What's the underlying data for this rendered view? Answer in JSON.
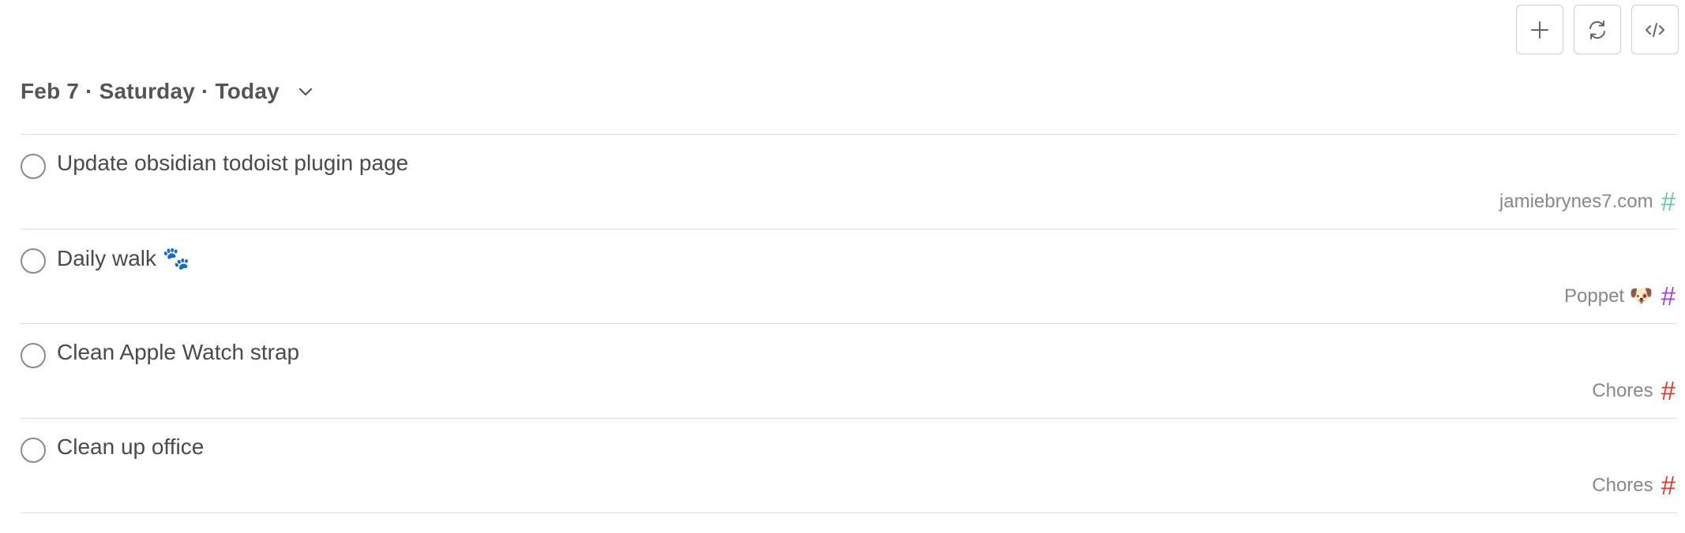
{
  "toolbar": {
    "add_icon": "plus-icon",
    "refresh_icon": "refresh-icon",
    "code_icon": "code-icon"
  },
  "header": {
    "title": "Feb 7 · Saturday · Today",
    "chevron_icon": "chevron-down-icon"
  },
  "tasks": [
    {
      "title": "Update obsidian todoist plugin page",
      "project": "jamiebrynes7.com",
      "hash": "#",
      "project_color": "#6cc7a7"
    },
    {
      "title": "Daily walk 🐾",
      "project": "Poppet 🐶",
      "hash": "#",
      "project_color": "#a13fd6"
    },
    {
      "title": "Clean Apple Watch strap",
      "project": "Chores",
      "hash": "#",
      "project_color": "#e2382b"
    },
    {
      "title": "Clean up office",
      "project": "Chores",
      "hash": "#",
      "project_color": "#e2382b"
    }
  ]
}
